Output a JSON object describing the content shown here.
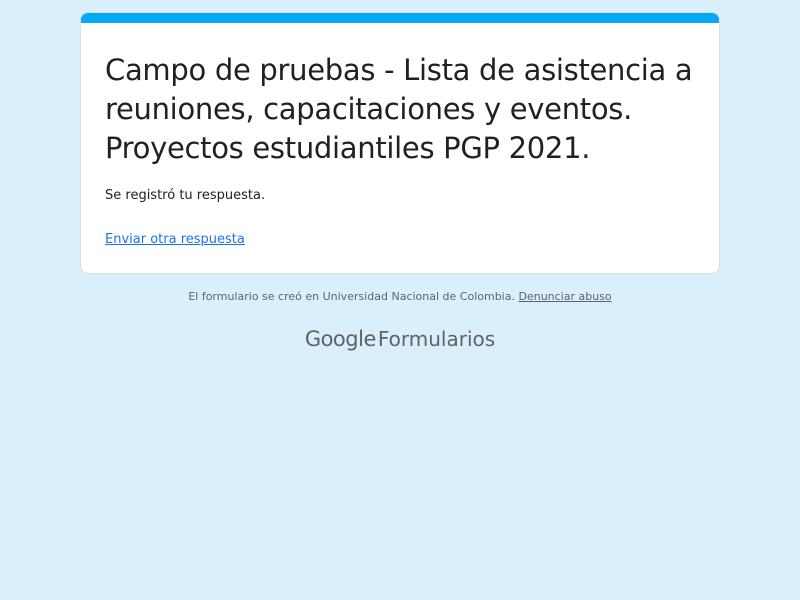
{
  "form": {
    "title": "Campo de pruebas - Lista de asistencia a reuniones, capacitaciones y eventos. Proyectos estudiantiles PGP 2021.",
    "confirmation_message": "Se registró tu respuesta.",
    "submit_another_label": "Enviar otra respuesta",
    "accent_color": "#03a9f4"
  },
  "footer": {
    "note": "El formulario se creó en Universidad Nacional de Colombia.",
    "report_abuse_label": "Denunciar abuso",
    "brand_google": "Google",
    "brand_product": "Formularios"
  },
  "colors": {
    "page_background": "#d9f0fc",
    "card_background": "#ffffff",
    "link": "#1a73e8"
  }
}
